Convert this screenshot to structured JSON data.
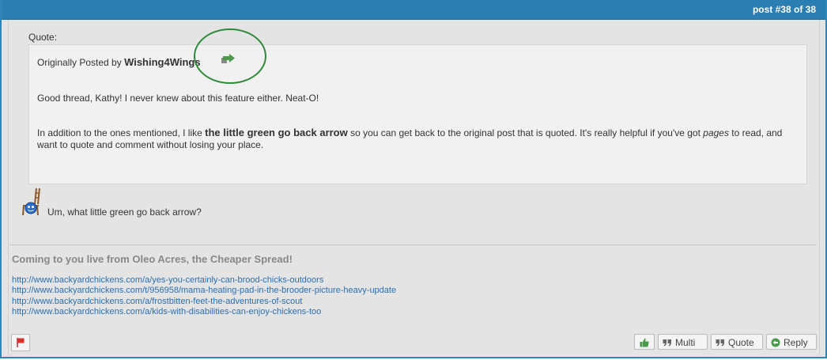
{
  "header": {
    "post_label": "post #38",
    "of_label": "of 38"
  },
  "quote": {
    "label": "Quote:",
    "posted_by_prefix": "Originally Posted by",
    "author": "Wishing4Wings",
    "line1": "Good thread, Kathy!  I never knew about this feature either.  Neat-O!",
    "p2_part1": "In addition to the ones mentioned, I like ",
    "p2_bold": "the little green go back arrow",
    "p2_part2": " so you can get back to the original post that is quoted.  It's really helpful if you've got ",
    "p2_italic": "pages",
    "p2_part3": " to read, and want to quote and comment without losing your place."
  },
  "reply": {
    "text": "Um, what little green go back arrow?"
  },
  "signature": {
    "title": "Coming to you live from Oleo Acres, the Cheaper Spread!",
    "links": [
      "http://www.backyardchickens.com/a/yes-you-certainly-can-brood-chicks-outdoors",
      "http://www.backyardchickens.com/t/956958/mama-heating-pad-in-the-brooder-picture-heavy-update",
      "http://www.backyardchickens.com/a/frostbitten-feet-the-adventures-of-scout",
      "http://www.backyardchickens.com/a/kids-with-disabilities-can-enjoy-chickens-too"
    ]
  },
  "buttons": {
    "multi": "Multi",
    "quote": "Quote",
    "reply": "Reply"
  },
  "colors": {
    "header": "#2a7eb1",
    "link": "#2a6fb0",
    "highlight_circle": "#2e8b3a",
    "back_arrow": "#4a9a4a"
  }
}
